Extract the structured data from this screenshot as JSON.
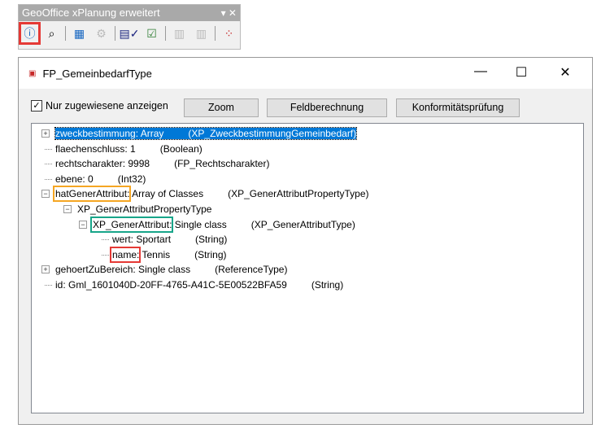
{
  "toolbar": {
    "title": "GeoOffice xPlanung erweitert",
    "icons": [
      "info-feature-icon",
      "binoculars-icon",
      "calculator-icon",
      "settings-disabled-icon",
      "table-check-icon",
      "grid-check-icon",
      "export-disabled-icon",
      "import-disabled-icon",
      "point-edit-icon"
    ]
  },
  "window": {
    "title": "FP_GemeinbedarfType",
    "minimize": "—",
    "maximize": "☐",
    "close": "✕"
  },
  "controls": {
    "checkbox_label": "Nur zugewiesene anzeigen",
    "checked": true,
    "zoom": "Zoom",
    "feldberechnung": "Feldberechnung",
    "konformitaet": "Konformitätsprüfung"
  },
  "tree": [
    {
      "name": "zweckbestimmung",
      "value": ": Array",
      "type": "(XP_ZweckbestimmungGemeinbedarf)",
      "expander": "+",
      "selected": true
    },
    {
      "name": "flaechenschluss",
      "value": ": 1",
      "type": "(Boolean)"
    },
    {
      "name": "rechtscharakter",
      "value": ": 9998",
      "type": "(FP_Rechtscharakter)"
    },
    {
      "name": "ebene",
      "value": ": 0",
      "type": "(Int32)"
    },
    {
      "name": "hatGenerAttribut",
      "value": ": Array of Classes",
      "type": "(XP_GenerAttributPropertyType)",
      "expander": "−"
    },
    {
      "name": "XP_GenerAttributPropertyType",
      "value": "",
      "type": "",
      "expander": "−"
    },
    {
      "name": "XP_GenerAttribut",
      "value": ": Single class",
      "type": "(XP_GenerAttributType)",
      "expander": "−"
    },
    {
      "name": "wert",
      "value": ": Sportart",
      "type": "(String)"
    },
    {
      "name": "name",
      "value": ": Tennis",
      "type": "(String)"
    },
    {
      "name": "gehoertZuBereich",
      "value": ": Single class",
      "type": "(ReferenceType)",
      "expander": "+"
    },
    {
      "name": "id",
      "value": ": Gml_1601040D-20FF-4765-A41C-5E00522BFA59",
      "type": "(String)"
    }
  ],
  "highlight_colors": {
    "toolbar_button": "#e53935",
    "hatGenerAttribut": "#f5a623",
    "XP_GenerAttribut": "#17a589",
    "name": "#e53935"
  }
}
